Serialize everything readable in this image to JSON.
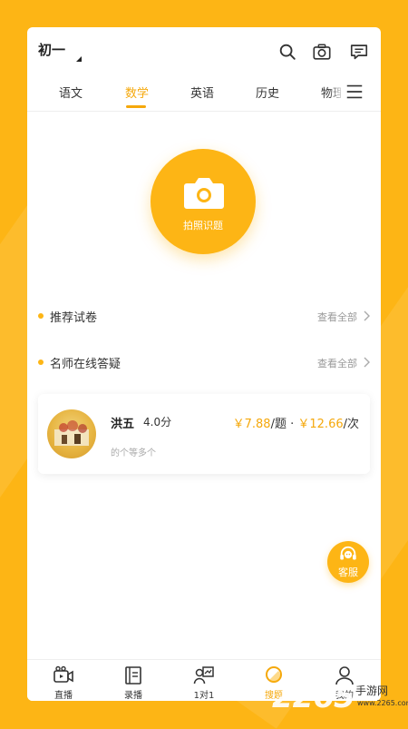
{
  "header": {
    "grade": "初一",
    "icons": [
      "search-icon",
      "camera-outline-icon",
      "message-icon"
    ]
  },
  "tabs": [
    {
      "label": "语文",
      "active": false
    },
    {
      "label": "数学",
      "active": true
    },
    {
      "label": "英语",
      "active": false
    },
    {
      "label": "历史",
      "active": false
    },
    {
      "label": "物理",
      "active": false
    }
  ],
  "camera": {
    "label": "拍照识题"
  },
  "sections": [
    {
      "title": "推荐试卷",
      "more": "查看全部"
    },
    {
      "title": "名师在线答疑",
      "more": "查看全部"
    }
  ],
  "teacher": {
    "name": "洪五",
    "score": "4.0分",
    "price_a_symbol": "￥",
    "price_a": "7.88",
    "price_a_unit": "/题",
    "separator": " · ",
    "price_b_symbol": "￥",
    "price_b": "12.66",
    "price_b_unit": "/次",
    "subtitle": "的个等多个"
  },
  "service": {
    "label": "客服"
  },
  "bottom_nav": [
    {
      "label": "直播",
      "icon": "video-icon"
    },
    {
      "label": "录播",
      "icon": "book-icon"
    },
    {
      "label": "1对1",
      "icon": "tutor-board-icon"
    },
    {
      "label": "搜题",
      "icon": "search-question-icon"
    },
    {
      "label": "我的",
      "icon": "user-icon"
    }
  ],
  "watermark": {
    "brand": "2265",
    "sub": "手游网",
    "url": "www.2265.com"
  },
  "colors": {
    "accent": "#FDB515",
    "accent_text": "#F5A80B",
    "background": "#FDB515"
  }
}
